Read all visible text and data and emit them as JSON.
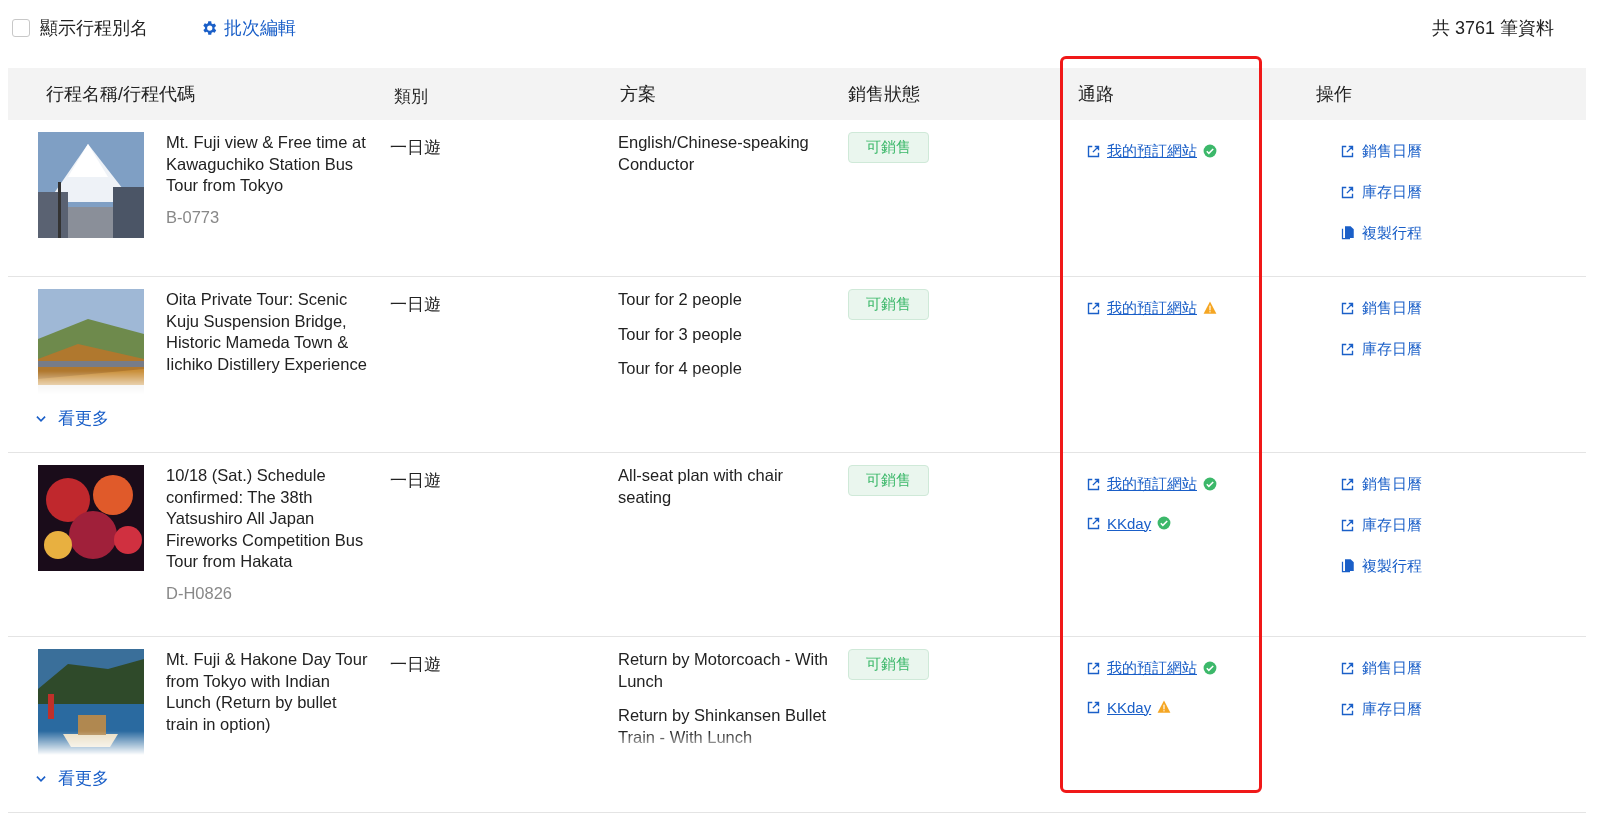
{
  "toolbar": {
    "show_alias": {
      "label": "顯示行程別名",
      "checked": false
    },
    "batch_edit": "批次編輯",
    "total": "共 3761 筆資料"
  },
  "columns": [
    {
      "label": "行程名稱/行程代碼",
      "highlighted": false
    },
    {
      "label": "類別",
      "highlighted": false
    },
    {
      "label": "方案",
      "highlighted": false
    },
    {
      "label": "銷售狀態",
      "highlighted": false
    },
    {
      "label": "通路",
      "highlighted": true
    },
    {
      "label": "操作",
      "highlighted": false
    }
  ],
  "rows": [
    {
      "name": "Mt. Fuji view & Free time at Kawaguchiko Station Bus Tour from Tokyo",
      "code": "B-0773",
      "picture": {
        "kind": "picture"
      },
      "type": "一日遊",
      "plans": [
        "English/Chinese-speaking Conductor"
      ],
      "status": "可銷售",
      "channels": [
        {
          "label": "我的預訂網站",
          "kind": "ok"
        }
      ],
      "actions": [
        {
          "label": "銷售日曆",
          "kind": "external"
        },
        {
          "label": "庫存日曆",
          "kind": "external"
        },
        {
          "label": "複製行程",
          "kind": "copy"
        }
      ],
      "collapsed": false
    },
    {
      "name": "Oita Private Tour: Scenic Kuju Suspension Bridge, Historic Mameda Town & Iichiko Distillery Experience",
      "picture": {
        "kind": "picture"
      },
      "type": "一日遊",
      "plans": [
        "Tour for 2 people",
        "Tour for 3 people",
        "Tour for 4 people"
      ],
      "status": "可銷售",
      "channels": [
        {
          "label": "我的預訂網站",
          "kind": "warning"
        }
      ],
      "actions": [
        {
          "label": "銷售日曆",
          "kind": "external"
        },
        {
          "label": "庫存日曆",
          "kind": "external"
        }
      ],
      "collapsed": true,
      "more": "看更多"
    },
    {
      "name": "10/18 (Sat.) Schedule confirmed: The 38th Yatsushiro All Japan Fireworks Competition Bus Tour from Hakata",
      "code": "D-H0826",
      "picture": {
        "kind": "picture"
      },
      "type": "一日遊",
      "plans": [
        "All-seat plan with chair seating"
      ],
      "status": "可銷售",
      "channels": [
        {
          "label": "我的預訂網站",
          "kind": "ok"
        },
        {
          "label": "KKday",
          "kind": "ok"
        }
      ],
      "actions": [
        {
          "label": "銷售日曆",
          "kind": "external"
        },
        {
          "label": "庫存日曆",
          "kind": "external"
        },
        {
          "label": "複製行程",
          "kind": "copy"
        }
      ],
      "collapsed": false
    },
    {
      "name": "Mt. Fuji & Hakone Day Tour from Tokyo with Indian Lunch (Return by bullet train in option)",
      "picture": {
        "kind": "picture"
      },
      "type": "一日遊",
      "plans": [
        "Return by Motorcoach - With Lunch",
        "Return by Shinkansen Bullet Train - With Lunch"
      ],
      "status": "可銷售",
      "channels": [
        {
          "label": "我的預訂網站",
          "kind": "ok"
        },
        {
          "label": "KKday",
          "kind": "warning"
        }
      ],
      "actions": [
        {
          "label": "銷售日曆",
          "kind": "external"
        },
        {
          "label": "庫存日曆",
          "kind": "external"
        }
      ],
      "collapsed": true,
      "more": "看更多"
    }
  ]
}
